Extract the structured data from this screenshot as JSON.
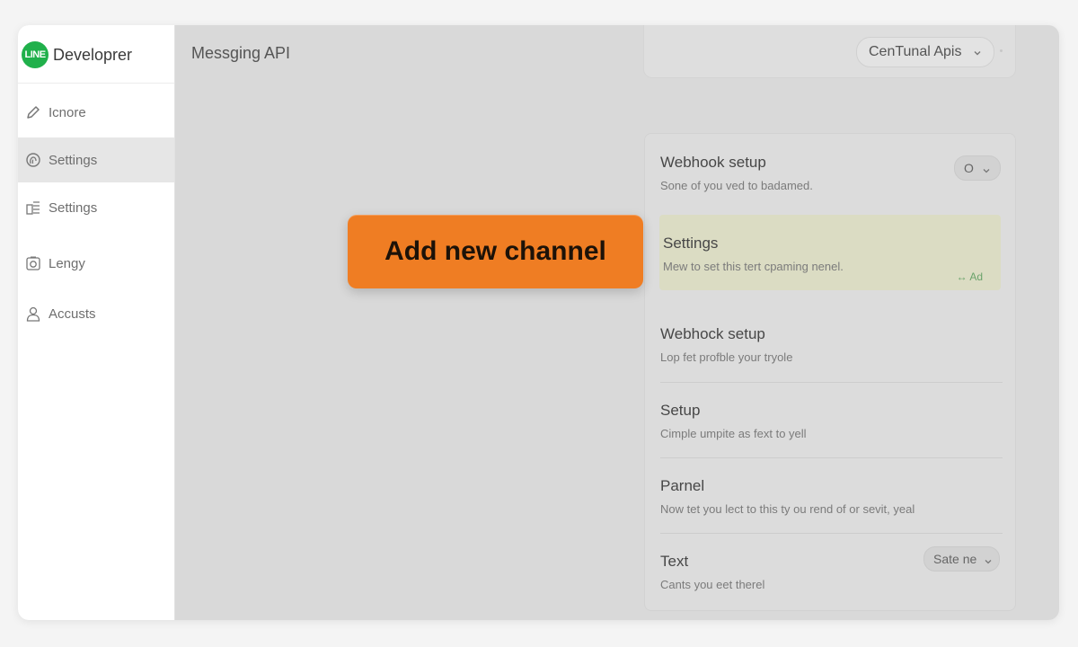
{
  "brand": {
    "logo_text": "LINE",
    "name": "Developrer"
  },
  "sidebar": {
    "items": [
      {
        "label": "Icnore",
        "icon": "pencil-icon"
      },
      {
        "label": "Settings",
        "icon": "fingerprint-icon",
        "active": true
      },
      {
        "label": "Settings",
        "icon": "list-icon"
      },
      {
        "label": "Lengy",
        "icon": "camera-icon"
      },
      {
        "label": "Accusts",
        "icon": "user-icon"
      }
    ]
  },
  "header": {
    "title": "Messging API",
    "app_select": "CenTunal Apis"
  },
  "cta": {
    "label": "Add new channel",
    "color": "#ef7d23"
  },
  "panel": {
    "rows": [
      {
        "title": "Webhook setup",
        "desc": "Sone of you ved to badamed.",
        "control": "O"
      },
      {
        "title": "Settings",
        "desc": "Mew to set this tert cpaming nenel.",
        "link": "↔ Ad",
        "highlight": true
      },
      {
        "title": "Webhock setup",
        "desc": "Lop fet profble your tryole"
      },
      {
        "title": "Setup",
        "desc": "Cimple umpite as fext to yell"
      },
      {
        "title": "Parnel",
        "desc": "Now tet you lect to this ty ou rend of or sevit, yeal"
      },
      {
        "title": "Text",
        "desc": "Cants you eet therel",
        "control": "Sate ne"
      }
    ]
  }
}
